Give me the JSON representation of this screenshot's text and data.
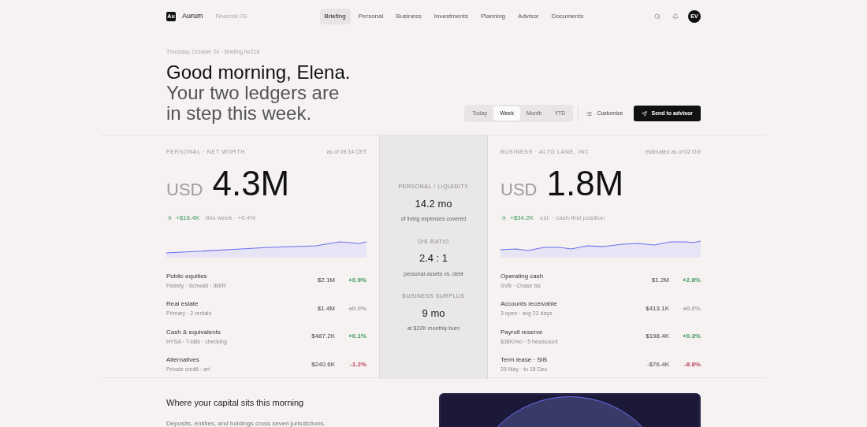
{
  "brand": {
    "logo": "Au",
    "name": "Aurum",
    "tagline": "Financial OS"
  },
  "nav": [
    {
      "label": "Briefing",
      "selected": true
    },
    {
      "label": "Personal",
      "selected": false
    },
    {
      "label": "Business",
      "selected": false
    },
    {
      "label": "Investments",
      "selected": false
    },
    {
      "label": "Planning",
      "selected": false
    },
    {
      "label": "Advisor",
      "selected": false
    },
    {
      "label": "Documents",
      "selected": false
    }
  ],
  "user": {
    "initials": "EV"
  },
  "hero": {
    "dateline": "Thursday, October 24 · Briefing №218",
    "greeting": "Good morning, Elena.",
    "subtitle": "Your two ledgers are in step this week."
  },
  "periods": [
    {
      "label": "Today",
      "selected": false
    },
    {
      "label": "Week",
      "selected": true
    },
    {
      "label": "Month",
      "selected": false
    },
    {
      "label": "YTD",
      "selected": false
    }
  ],
  "actions": {
    "customize": "Customize",
    "send": "Send to advisor"
  },
  "ledgers": [
    {
      "label": "PERSONAL · NET WORTH",
      "stamp": "as of 09:14 CET",
      "currency": "USD",
      "amount": "4.3M",
      "delta": "+$18.4K",
      "note": "this week · +0.4%",
      "rows": [
        {
          "name": "Public equities",
          "detail": "Fidelity · Schwab · IBKR",
          "value": "$2.1M",
          "change": "+0.9%",
          "color": "#3f9a5c"
        },
        {
          "name": "Real estate",
          "detail": "Primary · 2 rentals",
          "value": "$1.4M",
          "change": "±0.0%",
          "color": "#a8a4a4"
        },
        {
          "name": "Cash & equivalents",
          "detail": "HYSA · T-bills · checking",
          "value": "$487.2K",
          "change": "+0.1%",
          "color": "#3f9a5c"
        },
        {
          "name": "Alternatives",
          "detail": "Private credit · art",
          "value": "$240.6K",
          "change": "-1.2%",
          "color": "#c0405a"
        }
      ]
    },
    {
      "label": "BUSINESS · ALTO LANE, INC",
      "stamp": "estimated as of 02 Oct",
      "currency": "USD",
      "amount": "1.8M",
      "delta": "+$34.2K",
      "note": "est. · cash-first position",
      "rows": [
        {
          "name": "Operating cash",
          "detail": "SVB · Chase biz",
          "value": "$1.2M",
          "change": "+2.8%",
          "color": "#3f9a5c"
        },
        {
          "name": "Accounts receivable",
          "detail": "3 open · avg 22 days",
          "value": "$413.1K",
          "change": "±0.0%",
          "color": "#a8a4a4"
        },
        {
          "name": "Payroll reserve",
          "detail": "$38K/mo · 5 headcount",
          "value": "$198.4K",
          "change": "+0.3%",
          "color": "#3f9a5c"
        },
        {
          "name": "Term lease · SIB",
          "detail": "25 May · to 15 Dec",
          "value": "-$76.4K",
          "change": "-8.8%",
          "color": "#c0405a"
        }
      ]
    }
  ],
  "metrics": [
    {
      "label": "PERSONAL / LIQUIDITY",
      "value": "14.2 mo",
      "note": "of living expenses covered"
    },
    {
      "label": "D/E RATIO",
      "value": "2.4 : 1",
      "note": "personal assets vs. debt"
    },
    {
      "label": "BUSINESS SURPLUS",
      "value": "9 mo",
      "note": "at $22K monthly burn"
    }
  ],
  "capital": {
    "title": "Where your capital sits this morning",
    "description": "Deposits, entities, and holdings cross seven jurisdictions."
  }
}
